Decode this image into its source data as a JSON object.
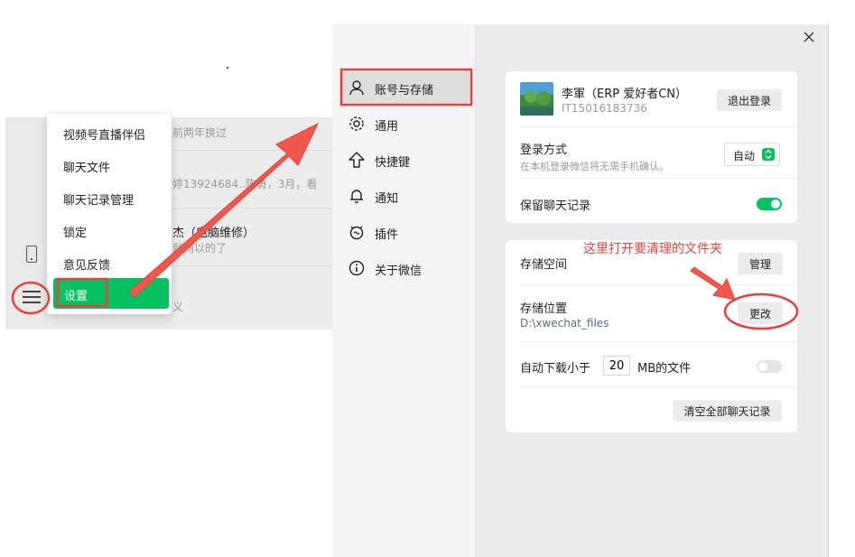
{
  "chat_list": {
    "items": [
      {
        "name": "",
        "msg": "前两年换过"
      },
      {
        "name": "",
        "msg": "婷13924684..陈勇，3月，看"
      },
      {
        "name": "杰（电脑维修）",
        "msg": "就网以的了"
      },
      {
        "name": "",
        "msg": "义"
      }
    ]
  },
  "popup_menu": {
    "items": [
      "视频号直播伴侣",
      "聊天文件",
      "聊天记录管理",
      "锁定",
      "意见反馈"
    ],
    "active": "设置"
  },
  "nav": {
    "items": [
      {
        "label": "账号与存储",
        "icon": "user-icon",
        "active": true
      },
      {
        "label": "通用",
        "icon": "gear-icon",
        "active": false
      },
      {
        "label": "快捷键",
        "icon": "shortcut-icon",
        "active": false
      },
      {
        "label": "通知",
        "icon": "bell-icon",
        "active": false
      },
      {
        "label": "插件",
        "icon": "plugin-icon",
        "active": false
      },
      {
        "label": "关于微信",
        "icon": "info-icon",
        "active": false
      }
    ]
  },
  "account": {
    "name": "李軍（ERP 爱好者CN）",
    "id": "IT15016183736",
    "logout_label": "退出登录",
    "login_method_label": "登录方式",
    "login_method_sub": "在本机登录微信将无需手机确认。",
    "login_method_value": "自动",
    "keep_history_label": "保留聊天记录",
    "keep_history_on": true
  },
  "storage": {
    "space_label": "存储空间",
    "manage_label": "管理",
    "location_label": "存储位置",
    "location_path": "D:\\xwechat_files",
    "change_label": "更改",
    "auto_download_prefix": "自动下载小于",
    "auto_download_value": "20",
    "auto_download_suffix": "MB的文件",
    "auto_download_on": false,
    "clear_all_label": "清空全部聊天记录"
  },
  "annotation": {
    "text": "这里打开要清理的文件夹",
    "color": "#e8413c"
  },
  "colors": {
    "accent_green": "#07c160",
    "annotation_red": "#e8413c"
  }
}
